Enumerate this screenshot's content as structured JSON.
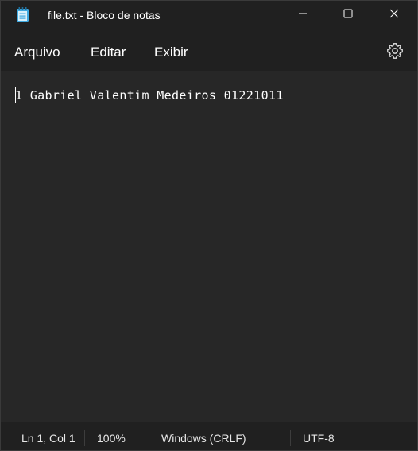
{
  "window": {
    "title": "file.txt - Bloco de notas",
    "app_icon": "notepad-icon",
    "controls": {
      "minimize_icon": "minimize-icon",
      "maximize_icon": "maximize-icon",
      "close_icon": "close-icon"
    }
  },
  "menu": {
    "items": [
      {
        "label": "Arquivo"
      },
      {
        "label": "Editar"
      },
      {
        "label": "Exibir"
      }
    ],
    "settings_icon": "gear-icon"
  },
  "editor": {
    "content": "1 Gabriel Valentim Medeiros 01221011"
  },
  "status": {
    "position": "Ln 1, Col 1",
    "zoom": "100%",
    "line_ending": "Windows (CRLF)",
    "encoding": "UTF-8"
  },
  "colors": {
    "background": "#272727",
    "chrome": "#202020",
    "text": "#ffffff",
    "icon_accent": "#3fa9e0"
  }
}
